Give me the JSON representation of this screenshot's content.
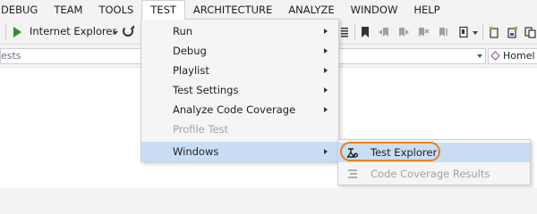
{
  "menubar": {
    "items": [
      "DEBUG",
      "TEAM",
      "TOOLS",
      "TEST",
      "ARCHITECTURE",
      "ANALYZE",
      "WINDOW",
      "HELP"
    ]
  },
  "toolbar": {
    "start_target": "Internet Explorer"
  },
  "search": {
    "value": "ests",
    "home_label": "Homel"
  },
  "test_menu": {
    "items": [
      {
        "label": "Run",
        "has_submenu": true,
        "enabled": true
      },
      {
        "label": "Debug",
        "has_submenu": true,
        "enabled": true
      },
      {
        "label": "Playlist",
        "has_submenu": true,
        "enabled": true
      },
      {
        "label": "Test Settings",
        "has_submenu": true,
        "enabled": true
      },
      {
        "label": "Analyze Code Coverage",
        "has_submenu": true,
        "enabled": true
      },
      {
        "label": "Profile Test",
        "has_submenu": false,
        "enabled": false
      },
      {
        "label": "Windows",
        "has_submenu": true,
        "enabled": true
      }
    ]
  },
  "windows_submenu": {
    "items": [
      {
        "label": "Test Explorer",
        "enabled": true,
        "icon": "test-explorer-icon"
      },
      {
        "label": "Code Coverage Results",
        "enabled": false,
        "icon": "code-coverage-icon"
      }
    ]
  },
  "colors": {
    "highlight": "#c9def5",
    "callout": "#e6821e",
    "play": "#388a34"
  }
}
